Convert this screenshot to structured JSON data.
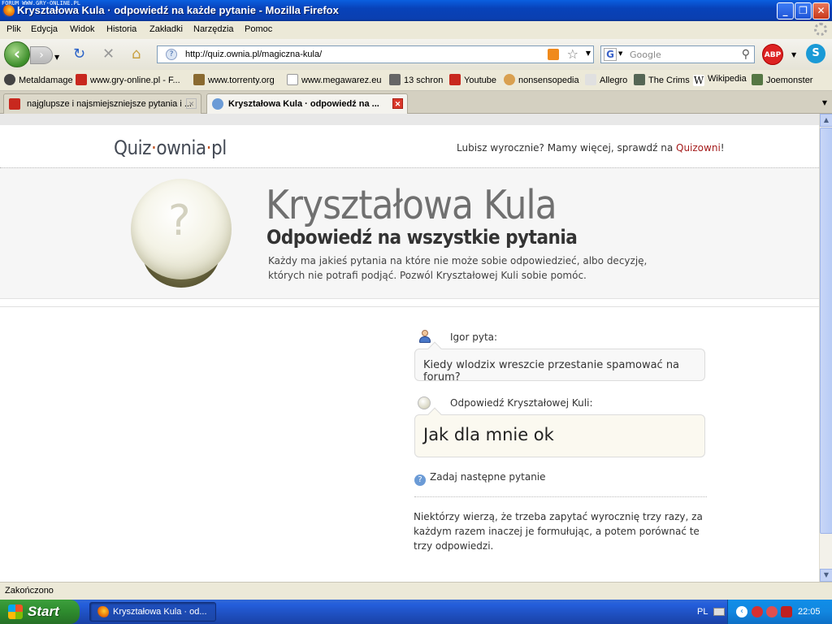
{
  "window": {
    "watermark": "FORUM WWW.GRY-ONLINE.PL",
    "title": "Kryształowa Kula · odpowiedź na każde pytanie - Mozilla Firefox",
    "minimize": "_",
    "maximize": "❐",
    "close": "✕"
  },
  "menu": [
    "Plik",
    "Edycja",
    "Widok",
    "Historia",
    "Zakładki",
    "Narzędzia",
    "Pomoc"
  ],
  "nav": {
    "url": "http://quiz.ownia.pl/magiczna-kula/",
    "search_placeholder": "Google",
    "abp_label": "ABP"
  },
  "bookmarks": [
    {
      "label": "Metaldamage",
      "icon": "disc-icon",
      "color": "#444444"
    },
    {
      "label": "www.gry-online.pl - F...",
      "icon": "g-icon",
      "color": "#c8281e"
    },
    {
      "label": "www.torrenty.org",
      "icon": "torrent-icon",
      "color": "#8a6a30"
    },
    {
      "label": "www.megawarez.eu",
      "icon": "page-icon",
      "color": "#ffffff"
    },
    {
      "label": "13 schron",
      "icon": "shelter-icon",
      "color": "#666666"
    },
    {
      "label": "Youtube",
      "icon": "youtube-icon",
      "color": "#c8281e"
    },
    {
      "label": "nonsensopedia",
      "icon": "potato-icon",
      "color": "#d9a050"
    },
    {
      "label": "Allegro",
      "icon": "hand-icon",
      "color": "#e0e0e0"
    },
    {
      "label": "The Crims",
      "icon": "crims-icon",
      "color": "#556655"
    },
    {
      "label": "Wikipedia",
      "icon": "wikipedia-icon",
      "color": "#ffffff"
    },
    {
      "label": "Joemonster",
      "icon": "monster-icon",
      "color": "#557744"
    }
  ],
  "tabs": [
    {
      "label": "najglupsze i najsmiejszniejsze pytania i ...",
      "active": false,
      "icon_color": "#c8281e"
    },
    {
      "label": "Kryształowa Kula · odpowiedź na ...",
      "active": true,
      "icon_color": "#6b9bd6"
    }
  ],
  "page": {
    "logo": {
      "a": "Quiz",
      "dot1": "·",
      "b": "ownia",
      "dot2": "·",
      "c": "pl"
    },
    "promo_text": "Lubisz wyrocznie? Mamy więcej, sprawdź na ",
    "promo_link": "Quizowni",
    "promo_end": "!",
    "orb_mark": "?",
    "title": "Kryształowa Kula",
    "subtitle": "Odpowiedź na wszystkie pytania",
    "intro": "Każdy ma jakieś pytania na które nie może sobie odpowiedzieć, albo decyzję, których nie potrafi podjąć. Pozwól Kryształowej Kuli sobie pomóc.",
    "asker_label": "Igor pyta:",
    "question": "Kiedy wlodzix wreszcie przestanie spamować na forum?",
    "answer_label": "Odpowiedź Kryształowej Kuli:",
    "answer": "Jak dla mnie ok",
    "ask_again": "Zadaj następne pytanie",
    "note": "Niektórzy wierzą, że trzeba zapytać wyrocznię trzy razy, za każdym razem inaczej je formułując, a potem porównać te trzy odpowiedzi."
  },
  "status": "Zakończono",
  "taskbar": {
    "start": "Start",
    "task": "Kryształowa Kula · od...",
    "lang": "PL",
    "clock": "22:05"
  }
}
